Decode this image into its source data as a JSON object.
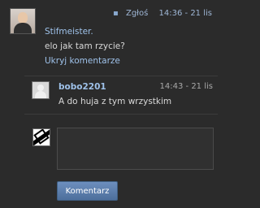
{
  "post": {
    "author": "Stifmeister.",
    "message": "elo jak tam rzycie?",
    "report_label": "Zgłoś",
    "time": "14:36 - 21 lis",
    "toggle_comments": "Ukryj komentarze"
  },
  "comment": {
    "author": "bobo2201",
    "time": "14:43 - 21 lis",
    "text": "A do huja z tym wrzystkim"
  },
  "reply": {
    "placeholder": "",
    "submit_label": "Komentarz"
  },
  "icons": {
    "report": "report-flag-icon",
    "user_avatar": "user-avatar-icon"
  },
  "colors": {
    "background": "#2b2b2b",
    "link": "#9fc2ea",
    "button": "#5b7fae"
  }
}
